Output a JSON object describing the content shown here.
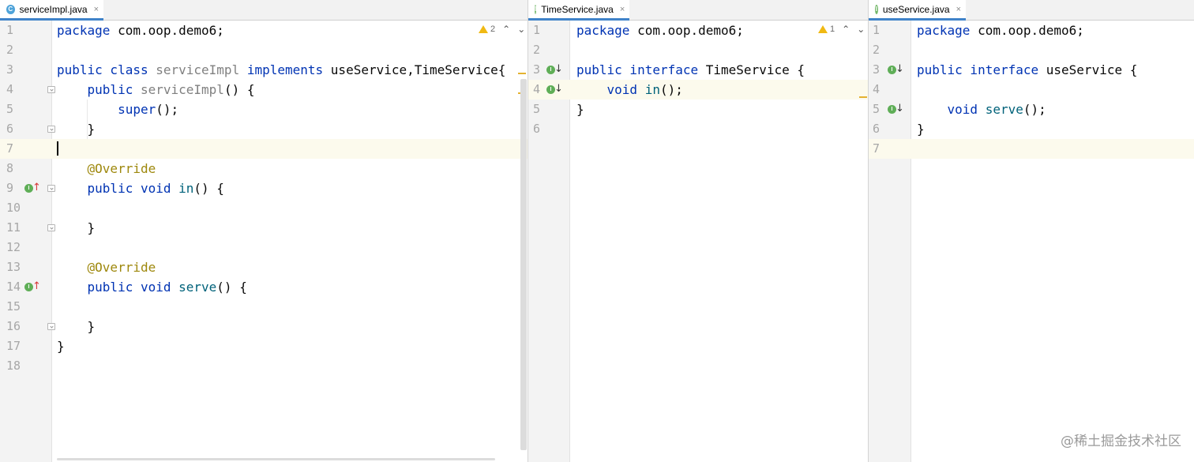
{
  "panes": [
    {
      "tab": {
        "label": "serviceImpl.java",
        "icon": "class-icon",
        "icon_letter": "C",
        "close": "×"
      },
      "inspection": {
        "count": "2",
        "up": "⌃",
        "down": "⌄"
      },
      "lines": [
        {
          "n": "1",
          "tokens": [
            [
              "kw",
              "package"
            ],
            [
              "cls",
              " com.oop.demo6;"
            ]
          ]
        },
        {
          "n": "2",
          "tokens": []
        },
        {
          "n": "3",
          "tokens": [
            [
              "kw",
              "public class "
            ],
            [
              "gray",
              "serviceImpl "
            ],
            [
              "kw",
              "implements "
            ],
            [
              "cls",
              "useService,TimeService{"
            ]
          ]
        },
        {
          "n": "4",
          "tokens": [
            [
              "cls",
              "    "
            ],
            [
              "kw",
              "public "
            ],
            [
              "gray",
              "serviceImpl"
            ],
            [
              "cls",
              "() {"
            ]
          ]
        },
        {
          "n": "5",
          "tokens": [
            [
              "cls",
              "        "
            ],
            [
              "kw",
              "super"
            ],
            [
              "cls",
              "();"
            ]
          ]
        },
        {
          "n": "6",
          "tokens": [
            [
              "cls",
              "    }"
            ]
          ]
        },
        {
          "n": "7",
          "tokens": []
        },
        {
          "n": "8",
          "tokens": [
            [
              "cls",
              "    "
            ],
            [
              "ann",
              "@Override"
            ]
          ]
        },
        {
          "n": "9",
          "tokens": [
            [
              "cls",
              "    "
            ],
            [
              "kw",
              "public void "
            ],
            [
              "mth",
              "in"
            ],
            [
              "cls",
              "() {"
            ]
          ]
        },
        {
          "n": "10",
          "tokens": []
        },
        {
          "n": "11",
          "tokens": [
            [
              "cls",
              "    }"
            ]
          ]
        },
        {
          "n": "12",
          "tokens": []
        },
        {
          "n": "13",
          "tokens": [
            [
              "cls",
              "    "
            ],
            [
              "ann",
              "@Override"
            ]
          ]
        },
        {
          "n": "14",
          "tokens": [
            [
              "cls",
              "    "
            ],
            [
              "kw",
              "public void "
            ],
            [
              "mth",
              "serve"
            ],
            [
              "cls",
              "() {"
            ]
          ]
        },
        {
          "n": "15",
          "tokens": []
        },
        {
          "n": "16",
          "tokens": [
            [
              "cls",
              "    }"
            ]
          ]
        },
        {
          "n": "17",
          "tokens": [
            [
              "cls",
              "}"
            ]
          ]
        },
        {
          "n": "18",
          "tokens": []
        }
      ]
    },
    {
      "tab": {
        "label": "TimeService.java",
        "icon": "interface-icon",
        "icon_letter": "I",
        "close": "×"
      },
      "inspection": {
        "count": "1",
        "up": "⌃",
        "down": "⌄"
      },
      "lines": [
        {
          "n": "1",
          "tokens": [
            [
              "kw",
              "package"
            ],
            [
              "cls",
              " com.oop.demo6;"
            ]
          ]
        },
        {
          "n": "2",
          "tokens": []
        },
        {
          "n": "3",
          "tokens": [
            [
              "kw",
              "public interface "
            ],
            [
              "cls",
              "TimeService {"
            ]
          ]
        },
        {
          "n": "4",
          "tokens": [
            [
              "cls",
              "    "
            ],
            [
              "kw",
              "void "
            ],
            [
              "mth",
              "in"
            ],
            [
              "cls",
              "();"
            ]
          ]
        },
        {
          "n": "5",
          "tokens": [
            [
              "cls",
              "}"
            ]
          ]
        },
        {
          "n": "6",
          "tokens": []
        }
      ]
    },
    {
      "tab": {
        "label": "useService.java",
        "icon": "interface-icon",
        "icon_letter": "I",
        "close": "×"
      },
      "lines": [
        {
          "n": "1",
          "tokens": [
            [
              "kw",
              "package"
            ],
            [
              "cls",
              " com.oop.demo6;"
            ]
          ]
        },
        {
          "n": "2",
          "tokens": []
        },
        {
          "n": "3",
          "tokens": [
            [
              "kw",
              "public interface "
            ],
            [
              "cls",
              "useService {"
            ]
          ]
        },
        {
          "n": "4",
          "tokens": []
        },
        {
          "n": "5",
          "tokens": [
            [
              "cls",
              "    "
            ],
            [
              "kw",
              "void "
            ],
            [
              "mth",
              "serve"
            ],
            [
              "cls",
              "();"
            ]
          ]
        },
        {
          "n": "6",
          "tokens": [
            [
              "cls",
              "}"
            ]
          ]
        },
        {
          "n": "7",
          "tokens": []
        }
      ]
    }
  ],
  "gutter_markers": {
    "implements_icon_letter": "I",
    "up_arrow": "↑",
    "down_arrow": "↓"
  },
  "watermark": "@稀土掘金技术社区",
  "colors": {
    "keyword": "#0033b3",
    "method": "#00627a",
    "annotation": "#9e880d",
    "identifier_gray": "#808080",
    "current_line": "#fcfaed",
    "tab_underline": "#4083c9",
    "warning": "#f0b913"
  }
}
